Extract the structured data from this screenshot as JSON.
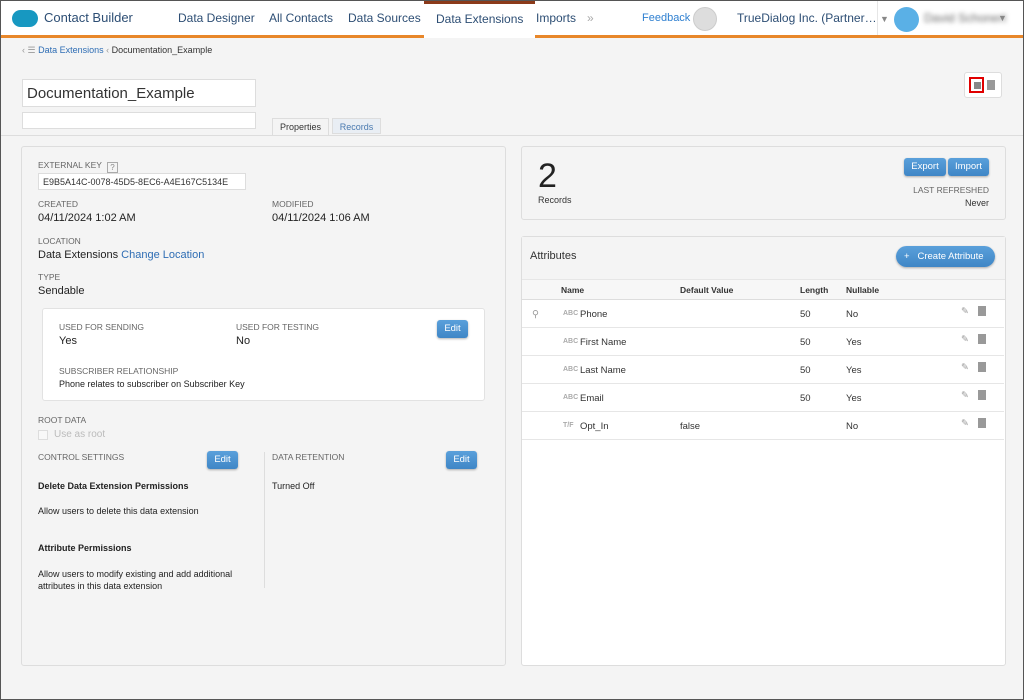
{
  "nav": {
    "app_title": "Contact Builder",
    "items": [
      "Data Designer",
      "All Contacts",
      "Data Sources",
      "Data Extensions",
      "Imports"
    ],
    "active": "Data Extensions",
    "more": "»",
    "feedback": "Feedback",
    "org": "TrueDialog Inc. (Partner…",
    "user": "David Schonert"
  },
  "breadcrumb": {
    "parent": "Data Extensions",
    "current": "Documentation_Example"
  },
  "de": {
    "name": "Documentation_Example",
    "description": ""
  },
  "tabs": [
    "Properties",
    "Records"
  ],
  "properties": {
    "external_key_label": "EXTERNAL KEY",
    "help": "?",
    "external_key": "E9B5A14C-0078-45D5-8EC6-A4E167C5134E",
    "created_label": "CREATED",
    "created": "04/11/2024 1:02 AM",
    "modified_label": "MODIFIED",
    "modified": "04/11/2024 1:06 AM",
    "location_label": "LOCATION",
    "location": "Data Extensions",
    "change_location": "Change Location",
    "type_label": "TYPE",
    "type": "Sendable",
    "sending_label": "USED FOR SENDING",
    "sending": "Yes",
    "testing_label": "USED FOR TESTING",
    "testing": "No",
    "edit": "Edit",
    "relationship_label": "SUBSCRIBER RELATIONSHIP",
    "relationship": "Phone relates to subscriber on Subscriber Key",
    "root_label": "ROOT DATA",
    "use_as_root": "Use as root",
    "control_label": "CONTROL SETTINGS",
    "delete_perm_title": "Delete Data Extension Permissions",
    "delete_perm_desc": "Allow users to delete this data extension",
    "attr_perm_title": "Attribute Permissions",
    "attr_perm_desc": "Allow users to modify existing and add additional attributes in this data extension",
    "retention_label": "DATA RETENTION",
    "retention": "Turned Off"
  },
  "records": {
    "count": "2",
    "label": "Records",
    "export": "Export",
    "import": "Import",
    "last_refreshed_label": "LAST REFRESHED",
    "last_refreshed": "Never"
  },
  "attributes": {
    "title": "Attributes",
    "create": "Create Attribute",
    "plus": "+",
    "columns": [
      "Name",
      "Default Value",
      "Length",
      "Nullable"
    ],
    "rows": [
      {
        "type": "ABC",
        "name": "Phone",
        "default": "",
        "length": "50",
        "nullable": "No",
        "primary_key": true
      },
      {
        "type": "ABC",
        "name": "First Name",
        "default": "",
        "length": "50",
        "nullable": "Yes"
      },
      {
        "type": "ABC",
        "name": "Last Name",
        "default": "",
        "length": "50",
        "nullable": "Yes"
      },
      {
        "type": "ABC",
        "name": "Email",
        "default": "",
        "length": "50",
        "nullable": "Yes"
      },
      {
        "type": "T/F",
        "name": "Opt_In",
        "default": "false",
        "length": "",
        "nullable": "No"
      }
    ]
  },
  "colors": {
    "accent": "#e8872a",
    "button": "#4a90d0",
    "link": "#2e6db4",
    "highlight": "#e00000"
  }
}
